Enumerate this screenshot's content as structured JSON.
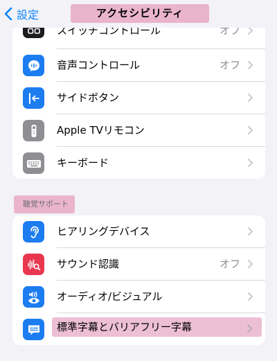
{
  "nav": {
    "back_label": "設定",
    "title": "アクセシビリティ"
  },
  "groups": [
    {
      "header": "",
      "items": [
        {
          "label": "スイッチコントロール",
          "value": "オフ",
          "icon": "switch-control-icon",
          "color": "#1c1c1e"
        },
        {
          "label": "音声コントロール",
          "value": "オフ",
          "icon": "voice-control-icon",
          "color": "#1c7cf0"
        },
        {
          "label": "サイドボタン",
          "value": "",
          "icon": "side-button-icon",
          "color": "#1c7cf0"
        },
        {
          "label": "Apple TVリモコン",
          "value": "",
          "icon": "apple-tv-remote-icon",
          "color": "#8e8e93"
        },
        {
          "label": "キーボード",
          "value": "",
          "icon": "keyboard-icon",
          "color": "#8e8e93"
        }
      ]
    },
    {
      "header": "聴覚サポート",
      "items": [
        {
          "label": "ヒアリングデバイス",
          "value": "",
          "icon": "ear-icon",
          "color": "#1c7cf0"
        },
        {
          "label": "サウンド認識",
          "value": "オフ",
          "icon": "sound-recognition-icon",
          "color": "#e8374f"
        },
        {
          "label": "オーディオ/ビジュアル",
          "value": "",
          "icon": "audio-visual-icon",
          "color": "#1c7cf0"
        },
        {
          "label": "標準字幕とバリアフリー字幕",
          "value": "",
          "icon": "subtitles-icon",
          "color": "#1c7cf0"
        }
      ]
    }
  ],
  "colors": {
    "accent": "#0a84ff",
    "highlight": "#eab4cc",
    "background": "#f2f2f7"
  }
}
